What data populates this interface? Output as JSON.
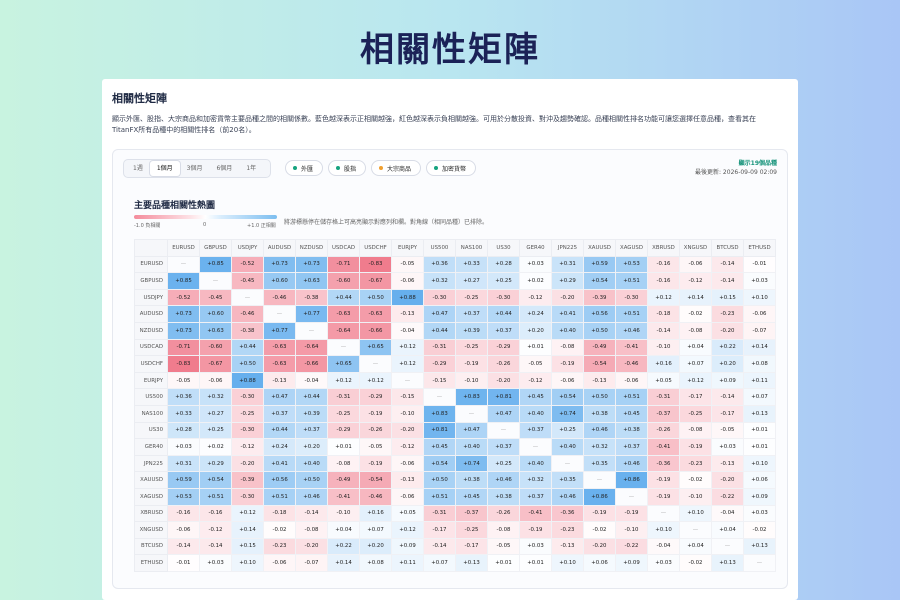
{
  "hero": {
    "title": "相關性矩陣"
  },
  "card": {
    "title": "相關性矩陣",
    "description": "顯示外匯、股指、大宗商品和加密貨幣主要品種之間的相關係數。藍色越深表示正相關越強，紅色越深表示負相關越強。可用於分散投資、對沖及趨勢確認。品種相關性排名功能可讓您選擇任意品種，查看其在TitanFX所有品種中的相關性排名（前20名）。"
  },
  "periods": [
    {
      "label": "1週",
      "active": false
    },
    {
      "label": "1個月",
      "active": true
    },
    {
      "label": "3個月",
      "active": false
    },
    {
      "label": "6個月",
      "active": false
    },
    {
      "label": "1年",
      "active": false
    }
  ],
  "filters": [
    {
      "label": "外匯",
      "color": "#16a37f"
    },
    {
      "label": "股指",
      "color": "#16a37f"
    },
    {
      "label": "大宗商品",
      "color": "#f0a030"
    },
    {
      "label": "加密貨幣",
      "color": "#16a37f"
    }
  ],
  "meta": {
    "count": "顯示19個品種",
    "updated": "最後更新: 2026-09-09 02:09"
  },
  "heatmap": {
    "title": "主要品種相關性熱圖",
    "legend_neg": "-1.0 負相關",
    "legend_zero": "0",
    "legend_pos": "+1.0 正相關",
    "note": "將游標懸停在儲存格上可高亮顯示對應列和欄。對角線（相同品種）已排除。"
  },
  "colors": {
    "positive": "#5aa9ec",
    "negative": "#ee6a7d"
  },
  "chart_data": {
    "type": "heatmap",
    "symbols": [
      "EURUSD",
      "GBPUSD",
      "USDJPY",
      "AUDUSD",
      "NZDUSD",
      "USDCAD",
      "USDCHF",
      "EURJPY",
      "US500",
      "NAS100",
      "US30",
      "GER40",
      "JPN225",
      "XAUUSD",
      "XAGUSD",
      "XBRUSD",
      "XNGUSD",
      "BTCUSD",
      "ETHUSD"
    ],
    "matrix": [
      [
        null,
        0.85,
        -0.52,
        0.73,
        0.73,
        -0.71,
        -0.83,
        -0.05,
        0.36,
        0.33,
        0.28,
        0.03,
        0.31,
        0.59,
        0.53,
        -0.16,
        -0.06,
        -0.14,
        -0.01
      ],
      [
        0.85,
        null,
        -0.45,
        0.6,
        0.63,
        -0.6,
        -0.67,
        -0.06,
        0.32,
        0.27,
        0.25,
        0.02,
        0.29,
        0.54,
        0.51,
        -0.16,
        -0.12,
        -0.14,
        0.03
      ],
      [
        -0.52,
        -0.45,
        null,
        -0.46,
        -0.38,
        0.44,
        0.5,
        0.88,
        -0.3,
        -0.25,
        -0.3,
        -0.12,
        -0.2,
        -0.39,
        -0.3,
        0.12,
        0.14,
        0.15,
        0.1
      ],
      [
        0.73,
        0.6,
        -0.46,
        null,
        0.77,
        -0.63,
        -0.63,
        -0.13,
        0.47,
        0.37,
        0.44,
        0.24,
        0.41,
        0.56,
        0.51,
        -0.18,
        -0.02,
        -0.23,
        -0.06
      ],
      [
        0.73,
        0.63,
        -0.38,
        0.77,
        null,
        -0.64,
        -0.66,
        -0.04,
        0.44,
        0.39,
        0.37,
        0.2,
        0.4,
        0.5,
        0.46,
        -0.14,
        -0.08,
        -0.2,
        -0.07
      ],
      [
        -0.71,
        -0.6,
        0.44,
        -0.63,
        -0.64,
        null,
        0.65,
        0.12,
        -0.31,
        -0.25,
        -0.29,
        0.01,
        -0.08,
        -0.49,
        -0.41,
        -0.1,
        0.04,
        0.22,
        0.14
      ],
      [
        -0.83,
        -0.67,
        0.5,
        -0.63,
        -0.66,
        0.65,
        null,
        0.12,
        -0.29,
        -0.19,
        -0.26,
        -0.05,
        -0.19,
        -0.54,
        -0.46,
        0.16,
        0.07,
        0.2,
        0.08
      ],
      [
        -0.05,
        -0.06,
        0.88,
        -0.13,
        -0.04,
        0.12,
        0.12,
        null,
        -0.15,
        -0.1,
        -0.2,
        -0.12,
        -0.06,
        -0.13,
        -0.06,
        0.05,
        0.12,
        0.09,
        0.11
      ],
      [
        0.36,
        0.32,
        -0.3,
        0.47,
        0.44,
        -0.31,
        -0.29,
        -0.15,
        null,
        0.83,
        0.81,
        0.45,
        0.54,
        0.5,
        0.51,
        -0.31,
        -0.17,
        -0.14,
        0.07
      ],
      [
        0.33,
        0.27,
        -0.25,
        0.37,
        0.39,
        -0.25,
        -0.19,
        -0.1,
        0.83,
        null,
        0.47,
        0.4,
        0.74,
        0.38,
        0.45,
        -0.37,
        -0.25,
        -0.17,
        0.13
      ],
      [
        0.28,
        0.25,
        -0.3,
        0.44,
        0.37,
        -0.29,
        -0.26,
        -0.2,
        0.81,
        0.47,
        null,
        0.37,
        0.25,
        0.46,
        0.38,
        -0.26,
        -0.08,
        -0.05,
        0.01
      ],
      [
        0.03,
        0.02,
        -0.12,
        0.24,
        0.2,
        0.01,
        -0.05,
        -0.12,
        0.45,
        0.4,
        0.37,
        null,
        0.4,
        0.32,
        0.37,
        -0.41,
        -0.19,
        0.03,
        0.01
      ],
      [
        0.31,
        0.29,
        -0.2,
        0.41,
        0.4,
        -0.08,
        -0.19,
        -0.06,
        0.54,
        0.74,
        0.25,
        0.4,
        null,
        0.35,
        0.46,
        -0.36,
        -0.23,
        -0.13,
        0.1
      ],
      [
        0.59,
        0.54,
        -0.39,
        0.56,
        0.5,
        -0.49,
        -0.54,
        -0.13,
        0.5,
        0.38,
        0.46,
        0.32,
        0.35,
        null,
        0.86,
        -0.19,
        -0.02,
        -0.2,
        0.06
      ],
      [
        0.53,
        0.51,
        -0.3,
        0.51,
        0.46,
        -0.41,
        -0.46,
        -0.06,
        0.51,
        0.45,
        0.38,
        0.37,
        0.46,
        0.86,
        null,
        -0.19,
        -0.1,
        -0.22,
        0.09
      ],
      [
        -0.16,
        -0.16,
        0.12,
        -0.18,
        -0.14,
        -0.1,
        0.16,
        0.05,
        -0.31,
        -0.37,
        -0.26,
        -0.41,
        -0.36,
        -0.19,
        -0.19,
        null,
        0.1,
        -0.04,
        0.03
      ],
      [
        -0.06,
        -0.12,
        0.14,
        -0.02,
        -0.08,
        0.04,
        0.07,
        0.12,
        -0.17,
        -0.25,
        -0.08,
        -0.19,
        -0.23,
        -0.02,
        -0.1,
        0.1,
        null,
        0.04,
        -0.02
      ],
      [
        -0.14,
        -0.14,
        0.15,
        -0.23,
        -0.2,
        0.22,
        0.2,
        0.09,
        -0.14,
        -0.17,
        -0.05,
        0.03,
        -0.13,
        -0.2,
        -0.22,
        -0.04,
        0.04,
        null,
        0.13
      ],
      [
        -0.01,
        0.03,
        0.1,
        -0.06,
        -0.07,
        0.14,
        0.08,
        0.11,
        0.07,
        0.13,
        0.01,
        0.01,
        0.1,
        0.06,
        0.09,
        0.03,
        -0.02,
        0.13,
        null
      ]
    ],
    "diagonal_label": "—"
  }
}
